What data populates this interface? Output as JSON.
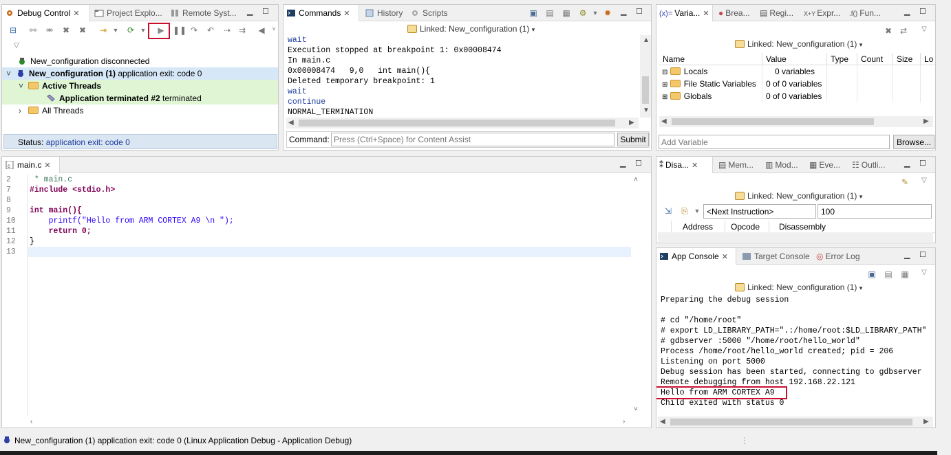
{
  "debug_control": {
    "tabs": [
      "Debug Control",
      "Project Explo...",
      "Remote Syst..."
    ],
    "tree": {
      "disconnected": "New_configuration disconnected",
      "config_name": "New_configuration (1)",
      "config_status": "application exit: code 0",
      "active_threads": "Active Threads",
      "thread_name": "Application terminated #2",
      "thread_status": "terminated",
      "all_threads": "All Threads"
    },
    "status_label": "Status:",
    "status_value": "application exit: code 0"
  },
  "commands": {
    "tabs": [
      "Commands",
      "History",
      "Scripts"
    ],
    "linked": "Linked: New_configuration (1)",
    "output_lines": [
      "wait",
      "Execution stopped at breakpoint 1: 0x00008474",
      "In main.c",
      "0x00008474   9,0   int main(){",
      "Deleted temporary breakpoint: 1",
      "wait",
      "continue",
      "NORMAL_TERMINATION"
    ],
    "command_label": "Command:",
    "command_placeholder": "Press (Ctrl+Space) for Content Assist",
    "submit_label": "Submit"
  },
  "variables": {
    "tabs": [
      "Varia...",
      "Brea...",
      "Regi...",
      "Expr...",
      "Fun..."
    ],
    "linked": "Linked: New_configuration (1)",
    "columns": [
      "Name",
      "Value",
      "Type",
      "Count",
      "Size",
      "Lo"
    ],
    "rows": [
      {
        "name": "Locals",
        "value": "0 variables"
      },
      {
        "name": "File Static Variables",
        "value": "0 of 0 variables"
      },
      {
        "name": "Globals",
        "value": "0 of 0 variables"
      }
    ],
    "add_placeholder": "Add Variable",
    "browse_label": "Browse..."
  },
  "editor": {
    "tab": "main.c",
    "line_numbers": [
      "2",
      "7",
      "8",
      "9",
      "10",
      "11",
      "12",
      "13"
    ],
    "code": [
      {
        "t": "comment",
        "s": " * main.c"
      },
      {
        "t": "include",
        "s": "#include <stdio.h>"
      },
      {
        "t": "blank",
        "s": ""
      },
      {
        "t": "kw",
        "s": "int main(){"
      },
      {
        "t": "call",
        "s": "    printf(\"Hello from ARM CORTEX A9 \\n \");"
      },
      {
        "t": "ret",
        "s": "    return 0;"
      },
      {
        "t": "plain",
        "s": "}"
      },
      {
        "t": "blank",
        "s": ""
      }
    ]
  },
  "disassembly": {
    "tabs": [
      "Disa...",
      "Mem...",
      "Mod...",
      "Eve...",
      "Outli..."
    ],
    "linked": "Linked: New_configuration (1)",
    "address_field": "<Next Instruction>",
    "count_field": "100",
    "columns": [
      "Address",
      "Opcode",
      "Disassembly"
    ]
  },
  "app_console": {
    "tabs": [
      "App Console",
      "Target Console",
      "Error Log"
    ],
    "linked": "Linked: New_configuration (1)",
    "lines": [
      "Preparing the debug session",
      "",
      "# cd \"/home/root\"",
      "# export LD_LIBRARY_PATH=\".:/home/root:$LD_LIBRARY_PATH\"",
      "# gdbserver :5000 \"/home/root/hello_world\"",
      "Process /home/root/hello_world created; pid = 206",
      "Listening on port 5000",
      "Debug session has been started, connecting to gdbserver",
      "Remote debugging from host 192.168.22.121",
      "Hello from ARM CORTEX A9",
      "Child exited with status 0"
    ]
  },
  "status_bar": {
    "text": "New_configuration (1) application exit: code 0 (Linux Application Debug - Application Debug)"
  },
  "colors": {
    "highlight_red": "#c8102e",
    "selected_row": "#d6e7f7",
    "thread_row": "#dff5d4",
    "status_link": "#1c3e9c"
  }
}
